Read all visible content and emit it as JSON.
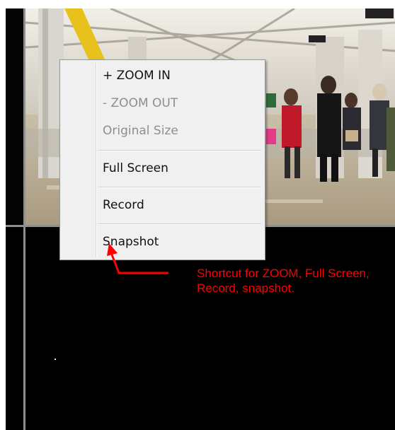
{
  "context_menu": {
    "items": [
      {
        "label": "+ ZOOM IN",
        "enabled": true
      },
      {
        "label": "- ZOOM OUT",
        "enabled": false
      },
      {
        "label": "Original Size",
        "enabled": false
      },
      {
        "label": "Full Screen",
        "enabled": true
      },
      {
        "label": "Record",
        "enabled": true
      },
      {
        "label": "Snapshot",
        "enabled": true
      }
    ]
  },
  "annotation": {
    "text": "Shortcut for ZOOM, Full Screen, Record, snapshot.",
    "color": "#ff0000"
  },
  "colors": {
    "viewer_background": "#000000",
    "pane_divider": "#8f8f8f",
    "menu_background": "#f0f0f0"
  }
}
